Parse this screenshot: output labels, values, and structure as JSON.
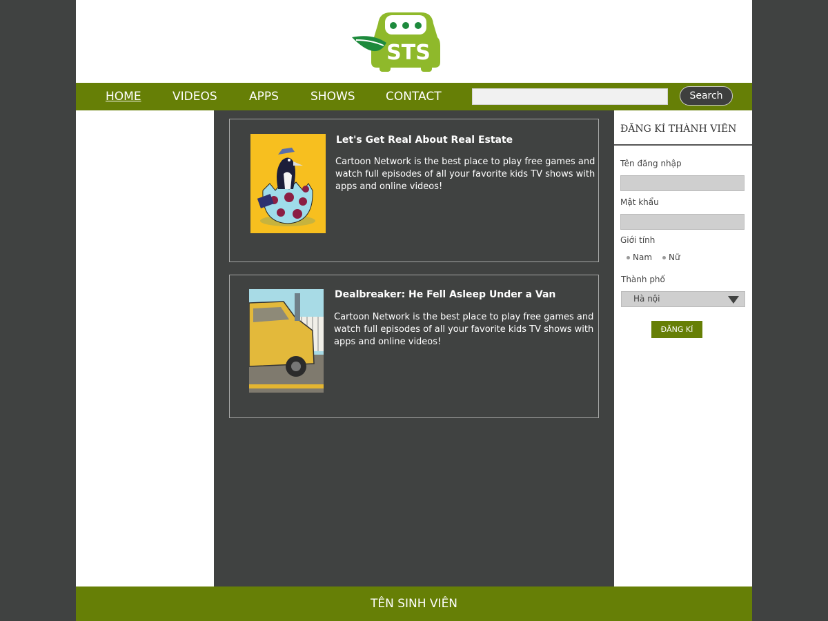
{
  "nav": {
    "items": [
      "HOME",
      "VIDEOS",
      "APPS",
      "SHOWS",
      "CONTACT"
    ],
    "active": "HOME",
    "search_placeholder": "",
    "search_button": "Search"
  },
  "logo": {
    "text": "STS"
  },
  "articles": [
    {
      "title": "Let's Get Real About Real Estate",
      "description": "Cartoon Network is the best place to play free games and watch full episodes of all your favorite kids TV shows with apps and online videos!"
    },
    {
      "title": "Dealbreaker: He Fell Asleep Under a Van",
      "description": "Cartoon Network is the best place to play free games and watch full episodes of all your favorite kids TV shows with apps and online videos!"
    }
  ],
  "register": {
    "title": "ĐĂNG KÍ THÀNH VIÊN",
    "username_label": "Tên đăng nhập",
    "password_label": "Mật khẩu",
    "gender_label": "Giới tính",
    "gender_options": [
      "Nam",
      "Nữ"
    ],
    "city_label": "Thành phố",
    "city_value": "Hà nội",
    "submit_label": "ĐĂNG KÍ"
  },
  "footer": {
    "text": "TÊN SINH VIÊN"
  },
  "colors": {
    "accent": "#667f06",
    "dark": "#404241",
    "logo_green": "#8fb92b"
  }
}
